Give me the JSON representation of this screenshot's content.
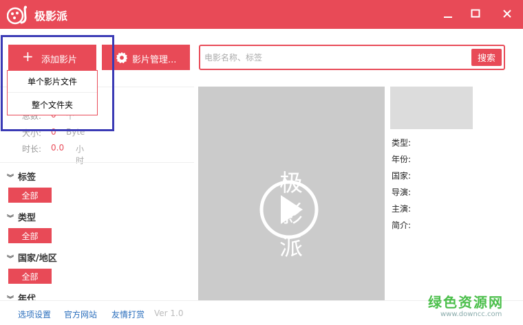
{
  "window": {
    "title": "极影派"
  },
  "toolbar": {
    "add_label": "添加影片",
    "manage_label": "影片管理..."
  },
  "dropdown": {
    "items": [
      "单个影片文件",
      "整个文件夹"
    ]
  },
  "search": {
    "placeholder": "电影名称、标签",
    "button": "搜索"
  },
  "stats": {
    "total_label": "总数:",
    "total_value": "0",
    "total_unit": "个",
    "size_label": "大小:",
    "size_value": "0",
    "size_unit": "Byte",
    "duration_label": "时长:",
    "duration_value": "0.0",
    "duration_unit": "小时"
  },
  "filters": [
    {
      "title": "标签",
      "button": "全部"
    },
    {
      "title": "类型",
      "button": "全部"
    },
    {
      "title": "国家/地区",
      "button": "全部"
    },
    {
      "title": "年代"
    }
  ],
  "details": {
    "fields": [
      "类型:",
      "年份:",
      "国家:",
      "导演:",
      "主演:",
      "简介:"
    ]
  },
  "poster": {
    "watermark_text": [
      "极",
      "影",
      "派"
    ]
  },
  "footer": {
    "links": [
      "选项设置",
      "官方网站",
      "友情打赏"
    ],
    "version": "Ver 1.0"
  },
  "site_watermark": {
    "name": "绿色资源网",
    "url": "www.downcc.com"
  },
  "colors": {
    "accent": "#e84a57",
    "highlight_box": "#3a3ab5",
    "link": "#2a6ebc"
  }
}
